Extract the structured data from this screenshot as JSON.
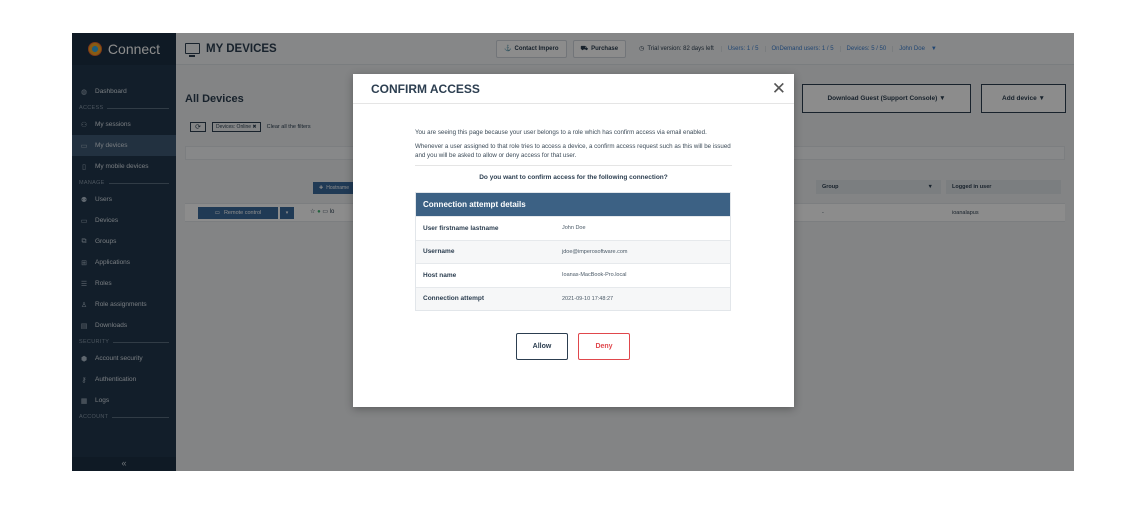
{
  "sidebar": {
    "brand": "Connect",
    "sections": {
      "access": "ACCESS",
      "manage": "MANAGE",
      "security": "SECURITY",
      "account": "ACCOUNT"
    },
    "items": {
      "dashboard": "Dashboard",
      "my_sessions": "My sessions",
      "my_devices": "My devices",
      "my_mobile_devices": "My mobile devices",
      "users": "Users",
      "devices": "Devices",
      "groups": "Groups",
      "applications": "Applications",
      "roles": "Roles",
      "role_assignments": "Role assignments",
      "downloads": "Downloads",
      "account_security": "Account security",
      "authentication": "Authentication",
      "logs": "Logs"
    },
    "collapse_glyph": "«"
  },
  "topbar": {
    "title": "MY DEVICES",
    "contact_label": "Contact Impero",
    "purchase_label": "Purchase",
    "trial_text": "Trial version: 82 days left",
    "users_text": "Users: 1 / 5",
    "ondemand_text": "OnDemand users: 1 / 5",
    "devices_text": "Devices: 5 / 50",
    "user_name": "John Doe"
  },
  "content": {
    "title": "All Devices",
    "filter_chip": "Devices: Online ✖",
    "clear_filters": "Clear all the filters",
    "hostname_label": "Hostname",
    "download_guest_label": "Download Guest (Support Console) ▼",
    "add_device_label": "Add device ▼",
    "columns": {
      "group": "Group",
      "logged_in_user": "Logged in user"
    },
    "row": {
      "remote_control_label": "Remote control",
      "host_prefix": "lo",
      "group": "-",
      "logged_in_user": "ioanalapus"
    }
  },
  "modal": {
    "title": "CONFIRM ACCESS",
    "close_glyph": "✕",
    "para1": "You are seeing this page because your user belongs to a role which has confirm access via email enabled.",
    "para2": "Whenever a user assigned to that role tries to access a device, a confirm access request such as this will be issued and you will be asked to allow or deny access for that user.",
    "question": "Do you want to confirm access for the following connection?",
    "details_title": "Connection attempt details",
    "details": [
      {
        "label": "User firstname lastname",
        "value": "John Doe"
      },
      {
        "label": "Username",
        "value": "jdoe@imperosoftware.com"
      },
      {
        "label": "Host name",
        "value": "Ioanas-MacBook-Pro.local"
      },
      {
        "label": "Connection attempt",
        "value": "2021-09-10 17:48:27"
      }
    ],
    "allow_label": "Allow",
    "deny_label": "Deny"
  }
}
